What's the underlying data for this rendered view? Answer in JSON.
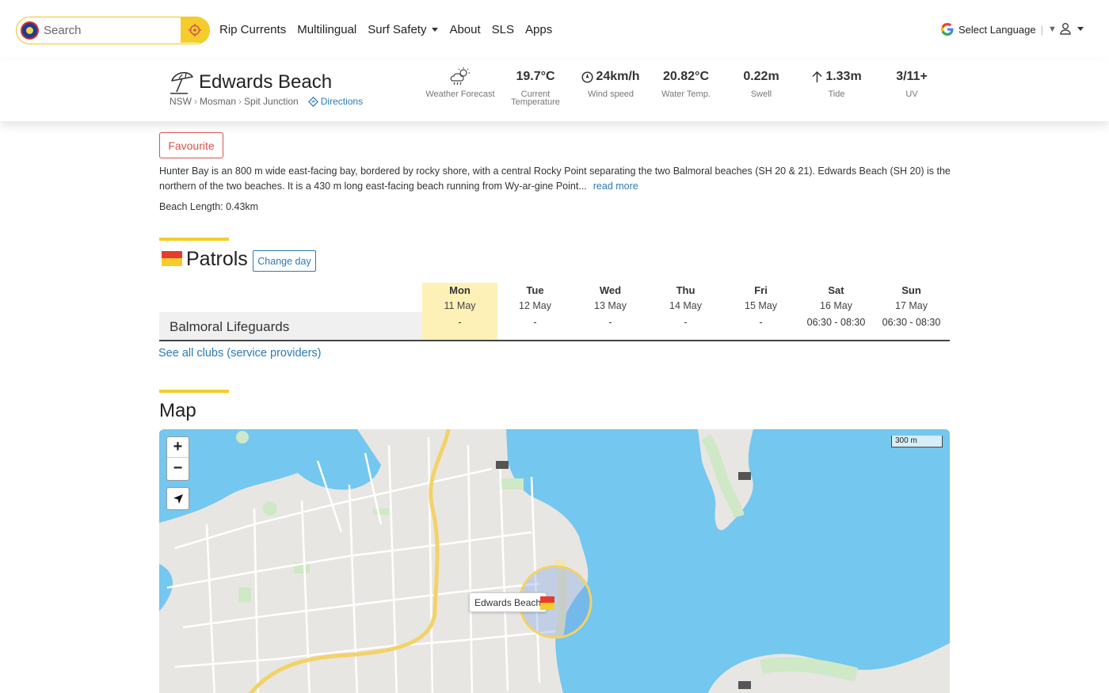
{
  "search": {
    "placeholder": "Search"
  },
  "nav": {
    "items": [
      "Rip Currents",
      "Multilingual",
      "Surf Safety",
      "About",
      "SLS",
      "Apps"
    ]
  },
  "language": {
    "label": "Select Language",
    "arrow": "▼"
  },
  "beach": {
    "name": "Edwards Beach",
    "breadcrumb": [
      "NSW",
      "Mosman",
      "Spit Junction"
    ],
    "directions": "Directions"
  },
  "conditions": [
    {
      "value": "",
      "label": "Weather Forecast",
      "icon": "cloud-rain-sun-icon"
    },
    {
      "value": "19.7°C",
      "label": "Current Temperature"
    },
    {
      "value": "24km/h",
      "label": "Wind speed",
      "icon": "compass-icon"
    },
    {
      "value": "20.82°C",
      "label": "Water Temp."
    },
    {
      "value": "0.22m",
      "label": "Swell"
    },
    {
      "value": "1.33m",
      "label": "Tide",
      "icon": "arrow-up-icon"
    },
    {
      "value": "3/11+",
      "label": "UV"
    }
  ],
  "favourite": "Favourite",
  "description": {
    "text": "Hunter Bay is an 800 m wide east-facing bay, bordered by rocky shore, with a central Rocky Point separating the two Balmoral beaches (SH 20 & 21). Edwards Beach (SH 20) is the northern of the two beaches. It is a 430 m long east-facing beach running from Wy-ar-gine Point...",
    "read_more": "read more"
  },
  "beach_length": "Beach Length: 0.43km",
  "patrols": {
    "title": "Patrols",
    "change_day": "Change day",
    "club": "Balmoral Lifeguards",
    "days": [
      {
        "name": "Mon",
        "date": "11 May",
        "time": "-",
        "today": true
      },
      {
        "name": "Tue",
        "date": "12 May",
        "time": "-"
      },
      {
        "name": "Wed",
        "date": "13 May",
        "time": "-"
      },
      {
        "name": "Thu",
        "date": "14 May",
        "time": "-"
      },
      {
        "name": "Fri",
        "date": "15 May",
        "time": "-"
      },
      {
        "name": "Sat",
        "date": "16 May",
        "time": "06:30 - 08:30"
      },
      {
        "name": "Sun",
        "date": "17 May",
        "time": "06:30 - 08:30"
      }
    ],
    "see_all": "See all clubs (service providers)"
  },
  "map": {
    "title": "Map",
    "scale": "300 m",
    "tooltip": "Edwards Beach",
    "zoom_in": "+",
    "zoom_out": "−"
  },
  "colors": {
    "accent_yellow": "#f5cd2a",
    "flag_red": "#e83a2d",
    "link_blue": "#2a7bb8",
    "water": "#74c7ee"
  }
}
